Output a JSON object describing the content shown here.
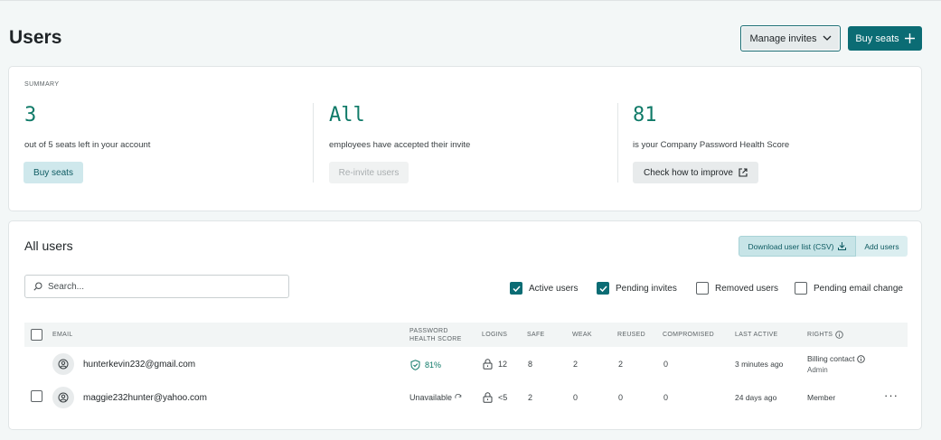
{
  "page": {
    "title": "Users"
  },
  "header": {
    "manage_invites_label": "Manage invites",
    "buy_seats_label": "Buy seats"
  },
  "summary": {
    "label": "SUMMARY",
    "seats": {
      "value": "3",
      "desc": "out of 5 seats left in your account",
      "button": "Buy seats"
    },
    "invites": {
      "value": "All",
      "desc": "employees have accepted their invite",
      "button": "Re-invite users"
    },
    "health": {
      "value": "81",
      "desc": "is your Company Password Health Score",
      "button": "Check how to improve"
    }
  },
  "all_users": {
    "title": "All users",
    "download_label": "Download user list (CSV)",
    "add_users_label": "Add users",
    "search_placeholder": "Search...",
    "filters": [
      {
        "label": "Active users",
        "checked": true
      },
      {
        "label": "Pending invites",
        "checked": true
      },
      {
        "label": "Removed users",
        "checked": false
      },
      {
        "label": "Pending email change",
        "checked": false
      }
    ],
    "columns": {
      "email": "EMAIL",
      "health_line1": "PASSWORD",
      "health_line2": "HEALTH SCORE",
      "logins": "LOGINS",
      "safe": "SAFE",
      "weak": "WEAK",
      "reused": "REUSED",
      "compromised": "COMPROMISED",
      "last_active": "LAST ACTIVE",
      "rights": "RIGHTS"
    },
    "rows": [
      {
        "email": "hunterkevin232@gmail.com",
        "health": "81%",
        "logins": "12",
        "safe": "8",
        "weak": "2",
        "reused": "2",
        "compromised": "0",
        "last_active": "3 minutes ago",
        "rights_primary": "Billing contact",
        "rights_secondary": "Admin"
      },
      {
        "email": "maggie232hunter@yahoo.com",
        "health": "Unavailable",
        "logins": "<5",
        "safe": "2",
        "weak": "0",
        "reused": "0",
        "compromised": "0",
        "last_active": "24 days ago",
        "rights_primary": "Member",
        "more": "···"
      }
    ]
  },
  "colors": {
    "accent": "#0b6c74",
    "stat_green": "#0f7a68",
    "background": "#f3f7f7"
  },
  "icons": [
    "chevron-down-icon",
    "plus-icon",
    "external-link-icon",
    "download-icon",
    "search-icon",
    "check-icon",
    "info-icon",
    "user-icon",
    "shield-icon",
    "lock-icon",
    "refresh-icon"
  ]
}
